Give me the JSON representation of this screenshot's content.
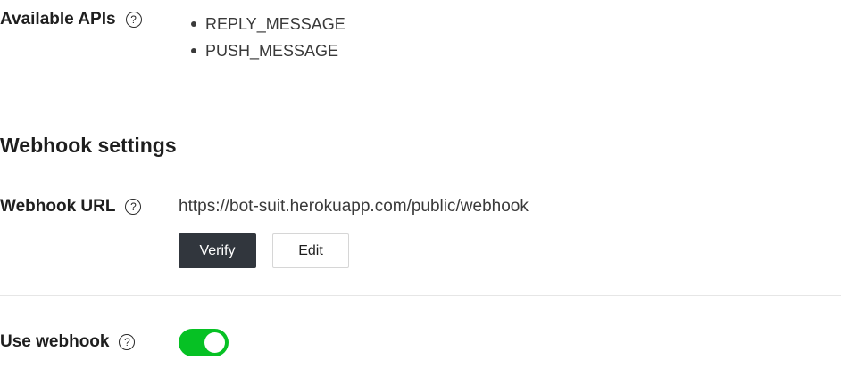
{
  "available_apis": {
    "label": "Available APIs",
    "help_icon": "question-circle-icon",
    "items": [
      "REPLY_MESSAGE",
      "PUSH_MESSAGE"
    ]
  },
  "webhook_settings": {
    "title": "Webhook settings",
    "webhook_url": {
      "label": "Webhook URL",
      "help_icon": "question-circle-icon",
      "value": "https://bot-suit.herokuapp.com/public/webhook",
      "verify_label": "Verify",
      "edit_label": "Edit"
    },
    "use_webhook": {
      "label": "Use webhook",
      "help_icon": "question-circle-icon",
      "enabled": true
    }
  },
  "colors": {
    "toggle_on": "#06c124",
    "verify_button": "#31363d"
  }
}
